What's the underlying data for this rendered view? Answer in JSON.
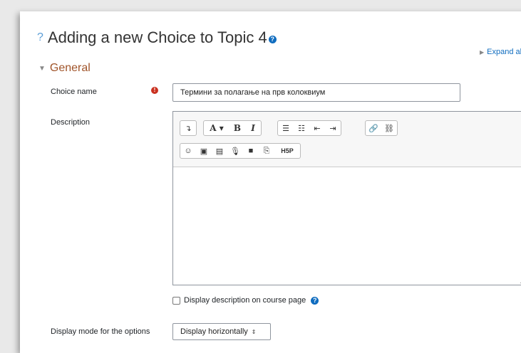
{
  "page": {
    "help_mark": "?",
    "title": "Adding a new Choice to Topic 4",
    "title_help_icon": "question-circle-icon",
    "expand_all": "Expand all"
  },
  "section": {
    "caret": "▼",
    "title": "General"
  },
  "fields": {
    "choice_name": {
      "label": "Choice name",
      "required_mark": "!",
      "value": "Термини за полагање на прв колоквиум"
    },
    "description": {
      "label": "Description",
      "toolbar_row1": [
        "paragraph-icon",
        "font-size-icon",
        "bold-icon",
        "italic-icon",
        "unordered-list-icon",
        "ordered-list-icon",
        "outdent-icon",
        "indent-icon",
        "link-icon",
        "unlink-icon"
      ],
      "toolbar_row2": [
        "emoticon-icon",
        "image-icon",
        "media-icon",
        "record-audio-icon",
        "record-video-icon",
        "manage-files-icon",
        "h5p-icon"
      ],
      "glyphs": {
        "para": "↴",
        "fontsize": "A ▾",
        "bold": "B",
        "italic": "I",
        "ul": "☰",
        "ol": "☷",
        "outdent": "⇤",
        "indent": "⇥",
        "link": "🔗",
        "unlink": "⛓",
        "emoticon": "☺",
        "image": "▣",
        "media": "▤",
        "audio": "🎙",
        "video": "■",
        "files": "⎘",
        "h5p": "H5P"
      },
      "value": ""
    },
    "display_description": {
      "label": "Display description on course page",
      "checked": false
    },
    "display_mode": {
      "label": "Display mode for the options",
      "value": "Display horizontally",
      "arrow": "⇕"
    }
  },
  "colors": {
    "section_title": "#a0542a",
    "link": "#0f6cbf",
    "required": "#ca3120",
    "help": "#0f6cbf"
  }
}
